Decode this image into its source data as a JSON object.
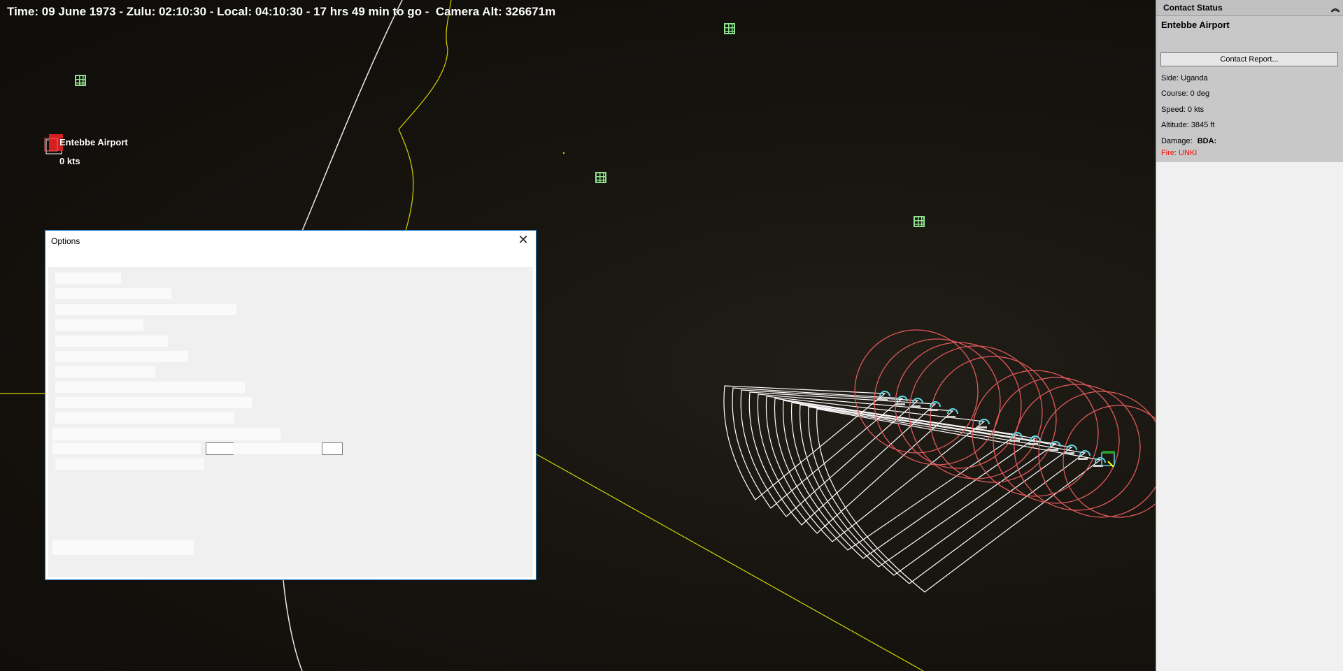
{
  "status_bar": {
    "time_text": "Time: 09 June 1973 - Zulu: 02:10:30 - Local: 04:10:30 - 17 hrs 49 min to go -  Camera Alt: 326671m"
  },
  "map": {
    "unit_label": {
      "name": "Entebbe Airport",
      "speed": "0 kts"
    },
    "colors": {
      "boundary_yellow": "#d4d400",
      "coast_white": "#e8e8e8",
      "range_rings_red": "#e05a5a",
      "sensor_arcs_white": "#ffffff",
      "aircraft_cyan": "#5fd7e6",
      "facility_green": "#8de38d",
      "hostile_red": "#ff2020"
    },
    "icons": [
      "facility-icon",
      "airbase-icon",
      "aircraft-icon"
    ]
  },
  "contact_status": {
    "header": "Contact Status",
    "collapse_icon": "double-chevron-up-icon",
    "name": "Entebbe Airport",
    "report_button": "Contact Report...",
    "side": "Side: Uganda",
    "course": "Course: 0 deg",
    "speed": "Speed: 0 kts",
    "altitude": "Altitude: 3845 ft",
    "damage_label": "Damage:",
    "bda_label": "BDA:",
    "fire": "Fire: UNKI",
    "fire_color": "#ff0000"
  },
  "options_dialog": {
    "title": "Options",
    "close": "✕"
  }
}
